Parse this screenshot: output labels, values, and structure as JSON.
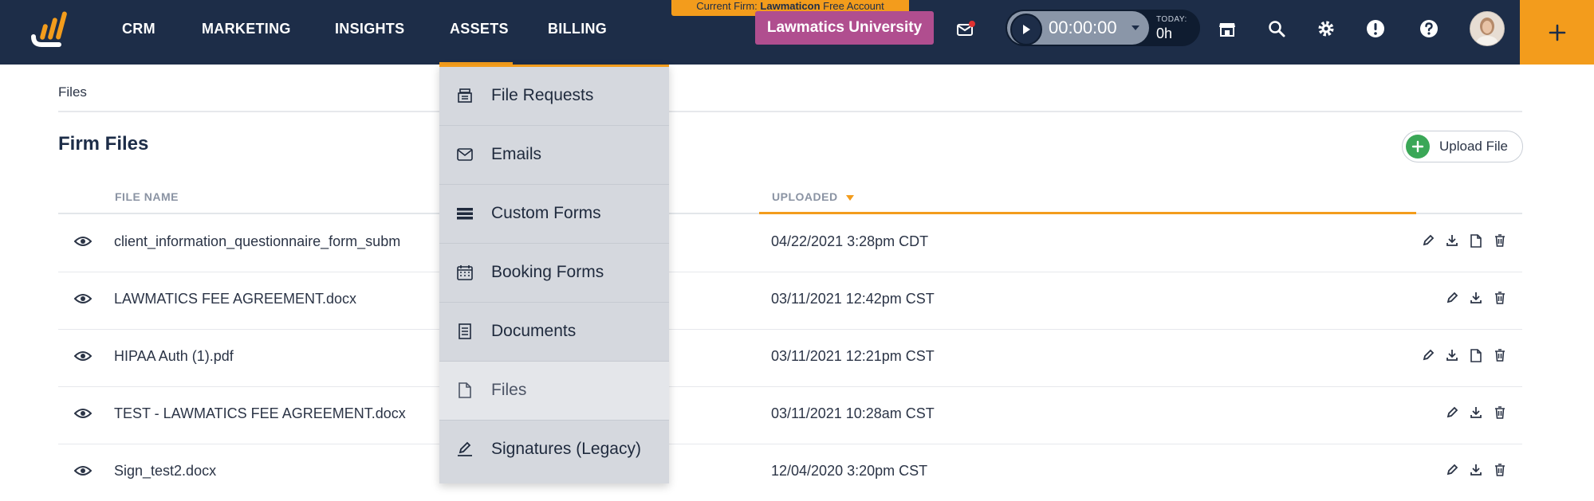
{
  "topbar": {
    "nav": [
      {
        "label": "CRM"
      },
      {
        "label": "MARKETING"
      },
      {
        "label": "INSIGHTS"
      },
      {
        "label": "ASSETS"
      },
      {
        "label": "BILLING"
      }
    ],
    "firm_banner": {
      "prefix": "Current Firm:",
      "firm": "Lawmaticon",
      "suffix": "Free Account"
    },
    "university_button": "Lawmatics University",
    "timer": {
      "value": "00:00:00",
      "today_label": "TODAY:",
      "today_value": "0h"
    },
    "icons": [
      "mail-icon",
      "store-icon",
      "search-icon",
      "gear-icon",
      "alert-icon",
      "help-icon"
    ],
    "colors": {
      "bar": "#1d2d48",
      "accent": "#f39c1c",
      "university": "#b04e8f"
    }
  },
  "breadcrumb": "Files",
  "page_title": "Firm Files",
  "upload_button": "Upload File",
  "table": {
    "columns": {
      "file_name": "FILE NAME",
      "uploaded": "UPLOADED"
    },
    "rows": [
      {
        "name": "client_information_questionnaire_form_subm",
        "uploaded": "04/22/2021 3:28pm CDT",
        "actions": [
          "edit",
          "download",
          "document",
          "trash"
        ]
      },
      {
        "name": "LAWMATICS FEE AGREEMENT.docx",
        "uploaded": "03/11/2021 12:42pm CST",
        "actions": [
          "edit",
          "download",
          "trash"
        ]
      },
      {
        "name": "HIPAA Auth (1).pdf",
        "uploaded": "03/11/2021 12:21pm CST",
        "actions": [
          "edit",
          "download",
          "document",
          "trash"
        ]
      },
      {
        "name": "TEST - LAWMATICS FEE AGREEMENT.docx",
        "uploaded": "03/11/2021 10:28am CST",
        "actions": [
          "edit",
          "download",
          "trash"
        ]
      },
      {
        "name": "Sign_test2.docx",
        "uploaded": "12/04/2020 3:20pm CST",
        "actions": [
          "edit",
          "download",
          "trash"
        ]
      }
    ]
  },
  "assets_menu": {
    "items": [
      {
        "label": "File Requests",
        "icon": "file-request-icon"
      },
      {
        "label": "Emails",
        "icon": "envelope-icon"
      },
      {
        "label": "Custom Forms",
        "icon": "forms-icon"
      },
      {
        "label": "Booking Forms",
        "icon": "calendar-icon"
      },
      {
        "label": "Documents",
        "icon": "document-icon"
      },
      {
        "label": "Files",
        "icon": "file-icon",
        "active": true
      },
      {
        "label": "Signatures (Legacy)",
        "icon": "signature-icon"
      }
    ]
  }
}
